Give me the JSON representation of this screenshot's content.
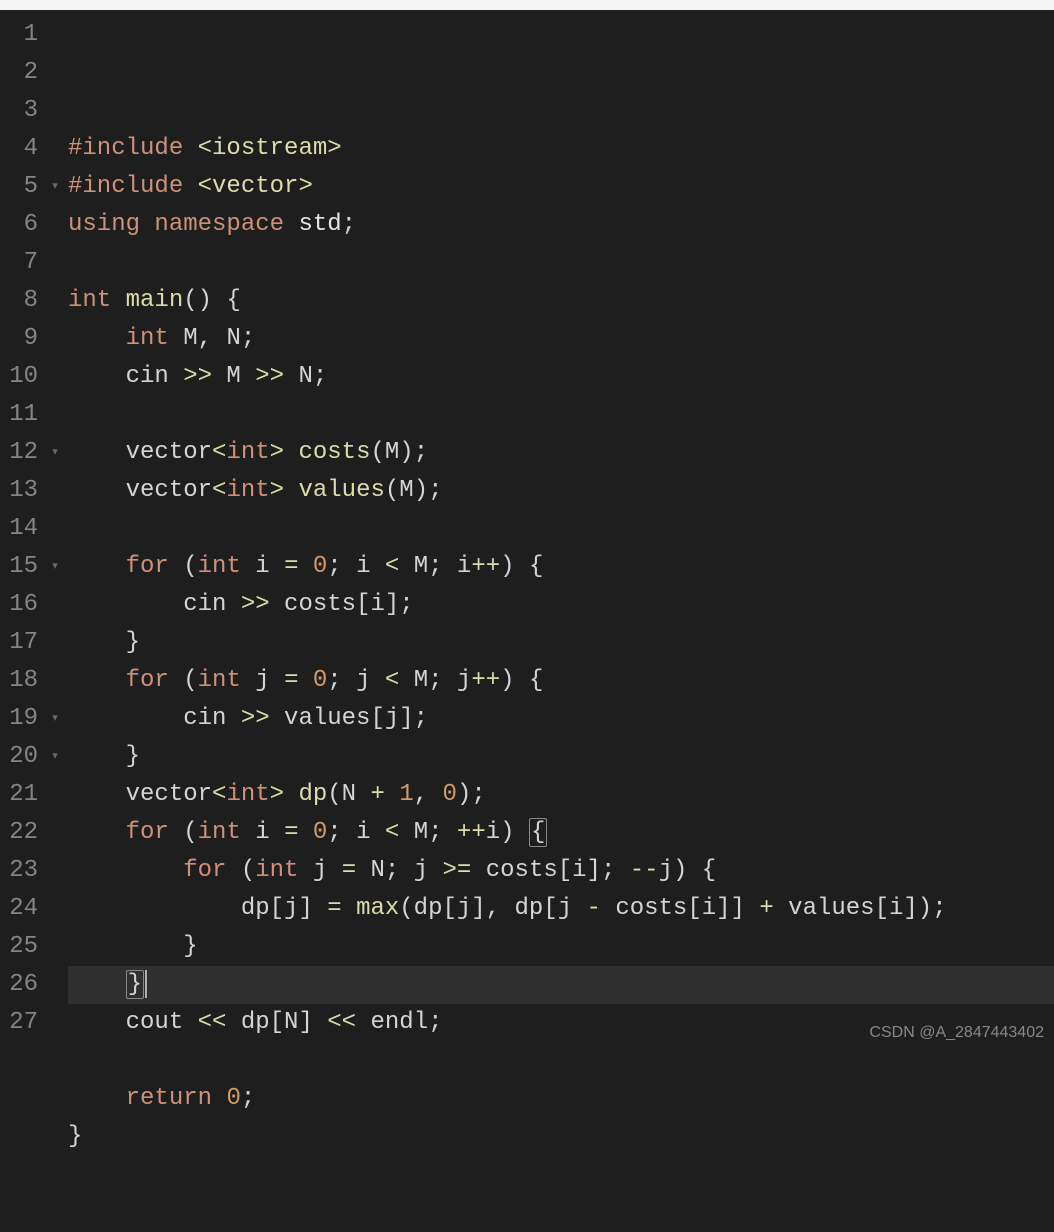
{
  "watermark": "CSDN @A_2847443402",
  "fold_markers": {
    "5": "▾",
    "12": "▾",
    "15": "▾",
    "19": "▾",
    "20": "▾"
  },
  "gutter_lines": [
    "1",
    "2",
    "3",
    "4",
    "5",
    "6",
    "7",
    "8",
    "9",
    "10",
    "11",
    "12",
    "13",
    "14",
    "15",
    "16",
    "17",
    "18",
    "19",
    "20",
    "21",
    "22",
    "23",
    "24",
    "25",
    "26",
    "27"
  ],
  "active_line": 23,
  "code": {
    "l1": [
      {
        "c": "t-include",
        "t": "#include"
      },
      {
        "c": "t-default",
        "t": " "
      },
      {
        "c": "t-op-yellow",
        "t": "<iostream>"
      }
    ],
    "l2": [
      {
        "c": "t-include",
        "t": "#include"
      },
      {
        "c": "t-default",
        "t": " "
      },
      {
        "c": "t-op-yellow",
        "t": "<vector>"
      }
    ],
    "l3": [
      {
        "c": "t-keyword",
        "t": "using"
      },
      {
        "c": "t-default",
        "t": " "
      },
      {
        "c": "t-keyword",
        "t": "namespace"
      },
      {
        "c": "t-default",
        "t": " "
      },
      {
        "c": "t-id",
        "t": "std"
      },
      {
        "c": "t-default",
        "t": ";"
      }
    ],
    "l4": [],
    "l5": [
      {
        "c": "t-keyword",
        "t": "int"
      },
      {
        "c": "t-default",
        "t": " "
      },
      {
        "c": "t-func",
        "t": "main"
      },
      {
        "c": "t-default",
        "t": "() {"
      }
    ],
    "l6": [
      {
        "c": "t-default",
        "t": "    "
      },
      {
        "c": "t-keyword",
        "t": "int"
      },
      {
        "c": "t-default",
        "t": " M, N;"
      }
    ],
    "l7": [
      {
        "c": "t-default",
        "t": "    cin "
      },
      {
        "c": "t-op-yellow",
        "t": ">>"
      },
      {
        "c": "t-default",
        "t": " M "
      },
      {
        "c": "t-op-yellow",
        "t": ">>"
      },
      {
        "c": "t-default",
        "t": " N;"
      }
    ],
    "l8": [],
    "l9": [
      {
        "c": "t-default",
        "t": "    vector"
      },
      {
        "c": "t-op-yellow",
        "t": "<"
      },
      {
        "c": "t-keyword",
        "t": "int"
      },
      {
        "c": "t-op-yellow",
        "t": ">"
      },
      {
        "c": "t-default",
        "t": " "
      },
      {
        "c": "t-func",
        "t": "costs"
      },
      {
        "c": "t-default",
        "t": "(M);"
      }
    ],
    "l10": [
      {
        "c": "t-default",
        "t": "    vector"
      },
      {
        "c": "t-op-yellow",
        "t": "<"
      },
      {
        "c": "t-keyword",
        "t": "int"
      },
      {
        "c": "t-op-yellow",
        "t": ">"
      },
      {
        "c": "t-default",
        "t": " "
      },
      {
        "c": "t-func",
        "t": "values"
      },
      {
        "c": "t-default",
        "t": "(M);"
      }
    ],
    "l11": [],
    "l12": [
      {
        "c": "t-default",
        "t": "    "
      },
      {
        "c": "t-keyword",
        "t": "for"
      },
      {
        "c": "t-default",
        "t": " ("
      },
      {
        "c": "t-keyword",
        "t": "int"
      },
      {
        "c": "t-default",
        "t": " i "
      },
      {
        "c": "t-op-yellow",
        "t": "="
      },
      {
        "c": "t-default",
        "t": " "
      },
      {
        "c": "t-num-orange",
        "t": "0"
      },
      {
        "c": "t-default",
        "t": "; i "
      },
      {
        "c": "t-op-yellow",
        "t": "<"
      },
      {
        "c": "t-default",
        "t": " M; i"
      },
      {
        "c": "t-op-yellow",
        "t": "++"
      },
      {
        "c": "t-default",
        "t": ") {"
      }
    ],
    "l13": [
      {
        "c": "t-default",
        "t": "        cin "
      },
      {
        "c": "t-op-yellow",
        "t": ">>"
      },
      {
        "c": "t-default",
        "t": " costs[i];"
      }
    ],
    "l14": [
      {
        "c": "t-default",
        "t": "    }"
      }
    ],
    "l15": [
      {
        "c": "t-default",
        "t": "    "
      },
      {
        "c": "t-keyword",
        "t": "for"
      },
      {
        "c": "t-default",
        "t": " ("
      },
      {
        "c": "t-keyword",
        "t": "int"
      },
      {
        "c": "t-default",
        "t": " j "
      },
      {
        "c": "t-op-yellow",
        "t": "="
      },
      {
        "c": "t-default",
        "t": " "
      },
      {
        "c": "t-num-orange",
        "t": "0"
      },
      {
        "c": "t-default",
        "t": "; j "
      },
      {
        "c": "t-op-yellow",
        "t": "<"
      },
      {
        "c": "t-default",
        "t": " M; j"
      },
      {
        "c": "t-op-yellow",
        "t": "++"
      },
      {
        "c": "t-default",
        "t": ") {"
      }
    ],
    "l16": [
      {
        "c": "t-default",
        "t": "        cin "
      },
      {
        "c": "t-op-yellow",
        "t": ">>"
      },
      {
        "c": "t-default",
        "t": " values[j];"
      }
    ],
    "l17": [
      {
        "c": "t-default",
        "t": "    }"
      }
    ],
    "l18": [
      {
        "c": "t-default",
        "t": "    vector"
      },
      {
        "c": "t-op-yellow",
        "t": "<"
      },
      {
        "c": "t-keyword",
        "t": "int"
      },
      {
        "c": "t-op-yellow",
        "t": ">"
      },
      {
        "c": "t-default",
        "t": " "
      },
      {
        "c": "t-func",
        "t": "dp"
      },
      {
        "c": "t-default",
        "t": "(N "
      },
      {
        "c": "t-op-yellow",
        "t": "+"
      },
      {
        "c": "t-default",
        "t": " "
      },
      {
        "c": "t-num-orange",
        "t": "1"
      },
      {
        "c": "t-default",
        "t": ", "
      },
      {
        "c": "t-num-orange",
        "t": "0"
      },
      {
        "c": "t-default",
        "t": ");"
      }
    ],
    "l19": [
      {
        "c": "t-default",
        "t": "    "
      },
      {
        "c": "t-keyword",
        "t": "for"
      },
      {
        "c": "t-default",
        "t": " ("
      },
      {
        "c": "t-keyword",
        "t": "int"
      },
      {
        "c": "t-default",
        "t": " i "
      },
      {
        "c": "t-op-yellow",
        "t": "="
      },
      {
        "c": "t-default",
        "t": " "
      },
      {
        "c": "t-num-orange",
        "t": "0"
      },
      {
        "c": "t-default",
        "t": "; i "
      },
      {
        "c": "t-op-yellow",
        "t": "<"
      },
      {
        "c": "t-default",
        "t": " M; "
      },
      {
        "c": "t-op-yellow",
        "t": "++"
      },
      {
        "c": "t-default",
        "t": "i) "
      },
      {
        "c": "t-default bracket-hl",
        "t": "{"
      }
    ],
    "l20": [
      {
        "c": "t-default",
        "t": "        "
      },
      {
        "c": "t-keyword",
        "t": "for"
      },
      {
        "c": "t-default",
        "t": " ("
      },
      {
        "c": "t-keyword",
        "t": "int"
      },
      {
        "c": "t-default",
        "t": " j "
      },
      {
        "c": "t-op-yellow",
        "t": "="
      },
      {
        "c": "t-default",
        "t": " N; j "
      },
      {
        "c": "t-op-yellow",
        "t": ">="
      },
      {
        "c": "t-default",
        "t": " costs[i]; "
      },
      {
        "c": "t-op-yellow",
        "t": "--"
      },
      {
        "c": "t-default",
        "t": "j) {"
      }
    ],
    "l21": [
      {
        "c": "t-default",
        "t": "            dp[j] "
      },
      {
        "c": "t-op-yellow",
        "t": "="
      },
      {
        "c": "t-default",
        "t": " "
      },
      {
        "c": "t-func",
        "t": "max"
      },
      {
        "c": "t-default",
        "t": "(dp[j], dp[j "
      },
      {
        "c": "t-op-yellow",
        "t": "-"
      },
      {
        "c": "t-default",
        "t": " costs[i]] "
      },
      {
        "c": "t-op-yellow",
        "t": "+"
      },
      {
        "c": "t-default",
        "t": " values[i]);"
      }
    ],
    "l22": [
      {
        "c": "t-default",
        "t": "        }"
      }
    ],
    "l23": [
      {
        "c": "t-default",
        "t": "    "
      },
      {
        "c": "t-default bracket-hl",
        "t": "}"
      },
      {
        "cursor": true
      }
    ],
    "l24": [
      {
        "c": "t-default",
        "t": "    cout "
      },
      {
        "c": "t-op-yellow",
        "t": "<<"
      },
      {
        "c": "t-default",
        "t": " dp[N] "
      },
      {
        "c": "t-op-yellow",
        "t": "<<"
      },
      {
        "c": "t-default",
        "t": " endl;"
      }
    ],
    "l25": [],
    "l26": [
      {
        "c": "t-default",
        "t": "    "
      },
      {
        "c": "t-keyword",
        "t": "return"
      },
      {
        "c": "t-default",
        "t": " "
      },
      {
        "c": "t-num-orange",
        "t": "0"
      },
      {
        "c": "t-default",
        "t": ";"
      }
    ],
    "l27": [
      {
        "c": "t-default",
        "t": "}"
      }
    ]
  }
}
